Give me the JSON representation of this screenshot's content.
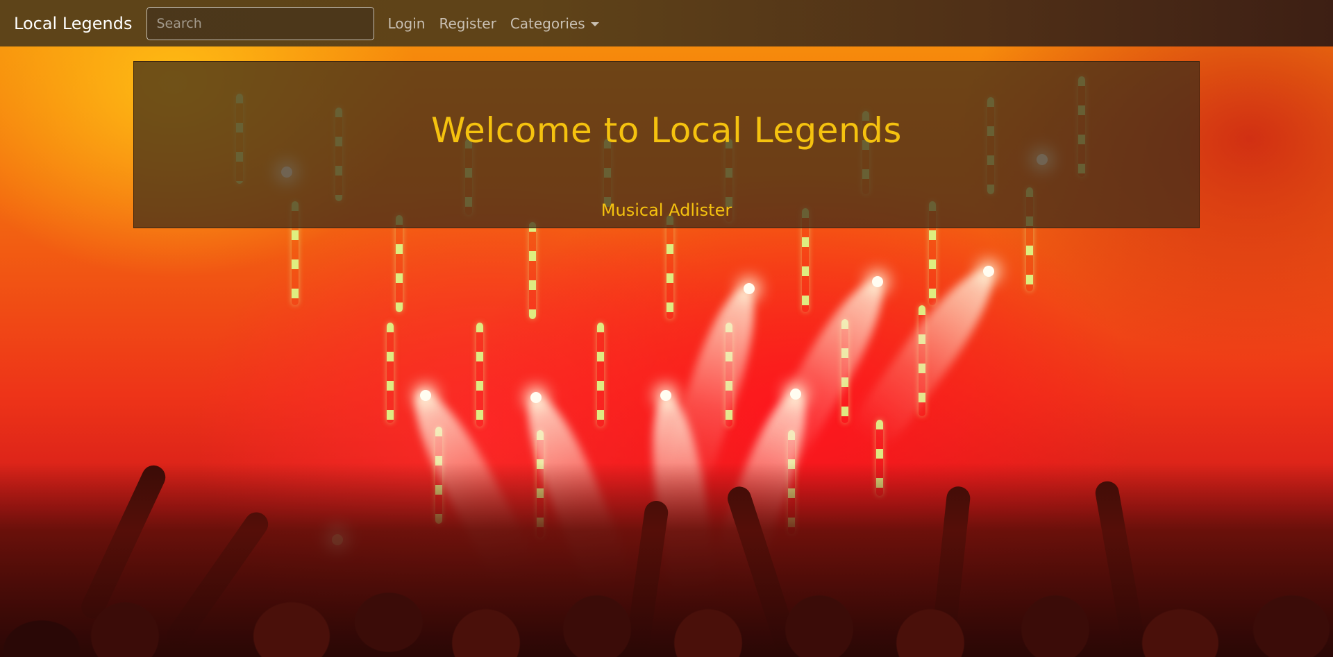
{
  "navbar": {
    "brand": "Local Legends",
    "search_placeholder": "Search",
    "links": [
      {
        "label": "Login"
      },
      {
        "label": "Register"
      },
      {
        "label": "Categories"
      }
    ]
  },
  "jumbotron": {
    "title": "Welcome to Local Legends",
    "subtitle": "Musical Adlister"
  },
  "colors": {
    "accent": "#f5c20f",
    "navbar_bg": "#5e4419",
    "nav_link": "#c9c0b3"
  },
  "background": {
    "description_icon": "concert-crowd-photo"
  }
}
